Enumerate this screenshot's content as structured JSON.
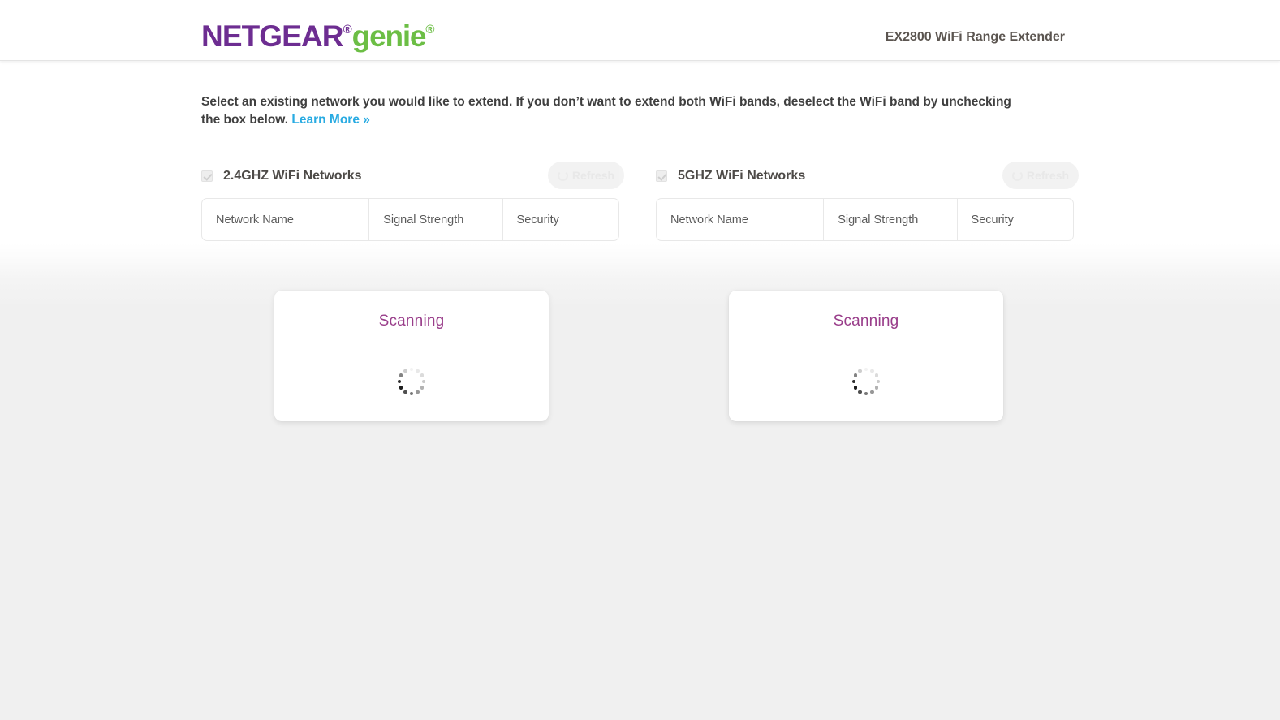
{
  "header": {
    "logo_brand": "NETGEAR",
    "logo_reg": "®",
    "logo_genie": "genie",
    "logo_genie_reg": "®",
    "device_name": "EX2800 WiFi Range Extender"
  },
  "main": {
    "instruction_line1": "Select an existing network you would like to extend. If you don’t want to extend both WiFi bands, deselect the WiFi band by",
    "instruction_line2": "unchecking the box below. ",
    "learn_more": "Learn More »",
    "columns": {
      "network_name": "Network Name",
      "signal_strength": "Signal Strength",
      "security": "Security"
    },
    "refresh_label": "Refresh",
    "scanning_label": "Scanning",
    "bands": [
      {
        "id": "2.4ghz",
        "title": "2.4GHZ WiFi Networks",
        "checked": true,
        "refresh": "Refresh",
        "scanning": "Scanning"
      },
      {
        "id": "5ghz",
        "title": "5GHZ WiFi Networks",
        "checked": true,
        "refresh": "Refresh",
        "scanning": "Scanning"
      }
    ]
  },
  "colors": {
    "brand_purple": "#6d2d91",
    "brand_green": "#6cbe45",
    "link_blue": "#29abe2",
    "scanning_purple": "#993d8a",
    "page_grey": "#f0f0f0",
    "header_white": "#ffffff",
    "border_grey": "#e8e8e8"
  }
}
